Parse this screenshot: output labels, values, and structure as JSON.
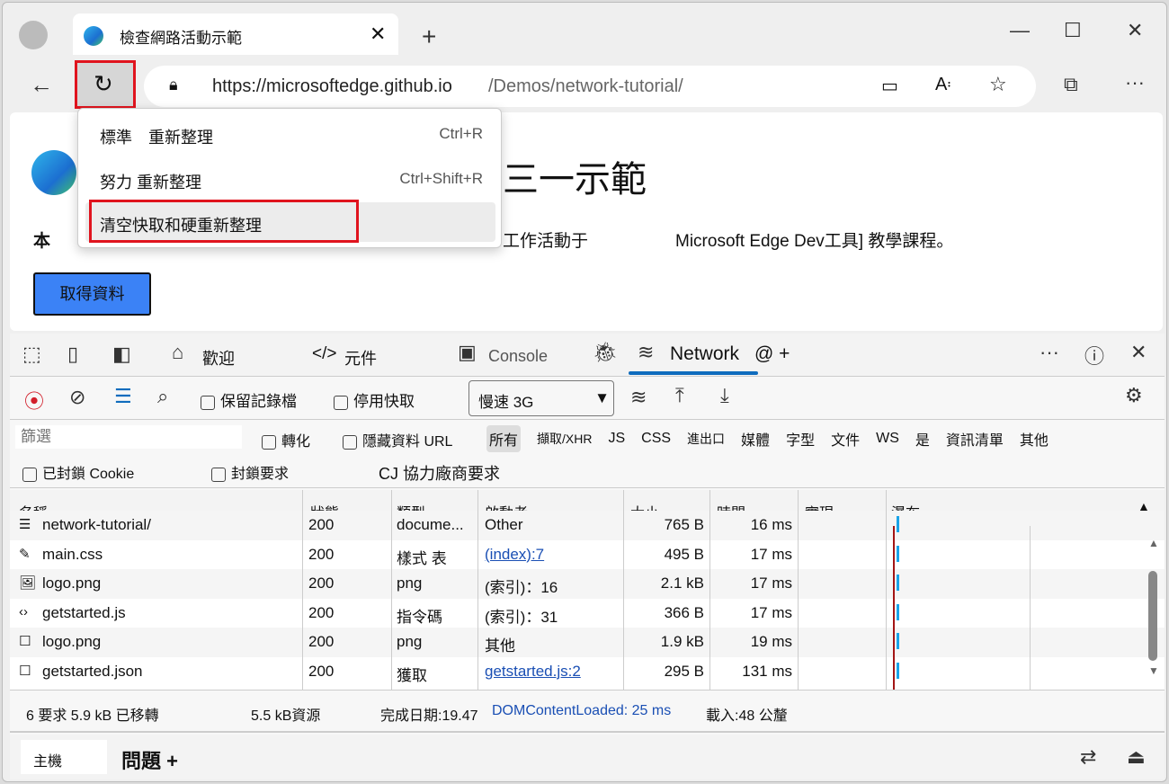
{
  "browser": {
    "tab_title": "檢查網路活動示範",
    "url_host": "https://microsoftedge.github.io",
    "url_path": "/Demos/network-tutorial/"
  },
  "menu": {
    "items": [
      {
        "label": "標準　重新整理",
        "shortcut": "Ctrl+R"
      },
      {
        "label": "努力 重新整理",
        "shortcut": "Ctrl+Shift+R"
      },
      {
        "label": "清空快取和硬重新整理",
        "shortcut": ""
      }
    ]
  },
  "page": {
    "heading": "三一示範",
    "intro_start": "本",
    "intro_mid": "工作活動于",
    "intro_link": "Microsoft Edge Dev工具]",
    "intro_end": " 教學課程。",
    "button": "取得資料",
    "accent": "#3b82f6"
  },
  "devtools": {
    "tabs": [
      "歡迎",
      "元件",
      "Console",
      "Network"
    ],
    "toolbar": {
      "preserve_log": "保留記錄檔",
      "disable_cache": "停用快取",
      "throttle": "慢速 3G"
    },
    "filter": {
      "placeholder": "篩選",
      "invert": "轉化",
      "hide_data": "隱藏資料 URL",
      "types": [
        "所有",
        "擷取/XHR",
        "JS",
        "CSS",
        "進出口",
        "媒體",
        "字型",
        "文件",
        "WS",
        "是",
        "資訊清單",
        "其他"
      ],
      "blocked_cookies": "已封鎖 Cookie",
      "blocked_requests": "封鎖要求",
      "third_party": "CJ 協力廠商要求"
    },
    "columns": [
      "名稱",
      "狀態",
      "類型",
      "啟動者",
      "大小",
      "時間",
      "實現。。。",
      "瀑布"
    ],
    "rows": [
      {
        "name": "network-tutorial/",
        "status": "200",
        "type": "docume...",
        "initiator": "Other",
        "size": "765 B",
        "time": "16 ms",
        "link": false
      },
      {
        "name": "main.css",
        "status": "200",
        "type": "樣式 表",
        "initiator": "(index):7",
        "size": "495 B",
        "time": "17 ms",
        "link": true
      },
      {
        "name": "logo.png",
        "status": "200",
        "type": "png",
        "initiator": "(索引)：16",
        "size": "2.1 kB",
        "time": "17 ms",
        "link": false
      },
      {
        "name": "getstarted.js",
        "status": "200",
        "type": "指令碼",
        "initiator": "(索引)：31",
        "size": "366 B",
        "time": "17 ms",
        "link": false
      },
      {
        "name": "logo.png",
        "status": "200",
        "type": "png",
        "initiator": "其他",
        "size": "1.9 kB",
        "time": "19 ms",
        "link": false
      },
      {
        "name": "getstarted.json",
        "status": "200",
        "type": "獲取",
        "initiator": "getstarted.js:2",
        "size": "295 B",
        "time": "131 ms",
        "link": true
      }
    ],
    "status": {
      "requests": "6 要求 5.9 kB 已移轉",
      "resources": "5.5 kB資源",
      "finish": "完成日期:19.47",
      "dcl": "DOMContentLoaded: 25 ms",
      "load": "載入:48 公釐"
    },
    "drawer": {
      "tab1": "主機",
      "tab2": "問題 +"
    }
  }
}
